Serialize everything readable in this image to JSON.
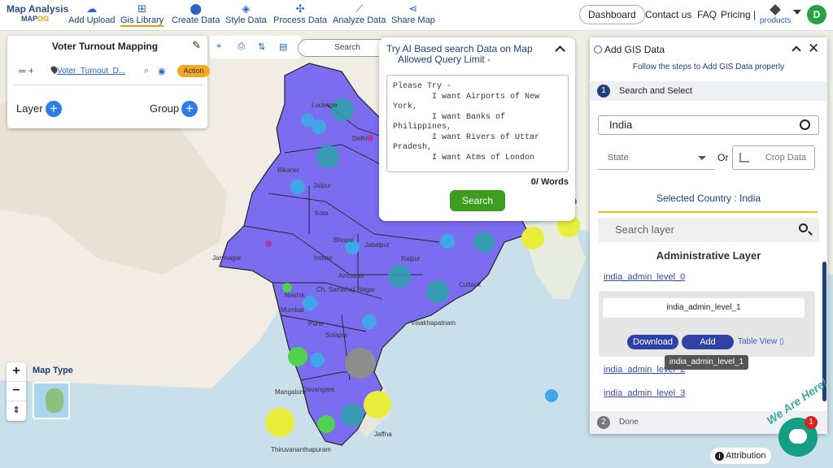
{
  "app": {
    "logo_line1": "Map Analysis",
    "logo_line2a": "MAP",
    "logo_line2b": "OG"
  },
  "nav": [
    {
      "label": "Add Upload",
      "icon": "cloud-upload-icon"
    },
    {
      "label": "Gis Library",
      "icon": "library-icon"
    },
    {
      "label": "Create Data",
      "icon": "pin-icon"
    },
    {
      "label": "Style Data",
      "icon": "paint-icon"
    },
    {
      "label": "Process Data",
      "icon": "process-icon"
    },
    {
      "label": "Analyze Data",
      "icon": "analyze-icon"
    },
    {
      "label": "Share Map",
      "icon": "share-icon"
    }
  ],
  "top_right": {
    "dashboard": "Dashboard",
    "contact": "Contact us",
    "faq": "FAQ",
    "pricing": "Pricing |",
    "products": "products",
    "avatar": "D"
  },
  "left_panel": {
    "title": "Voter Turnout Mapping",
    "layer_name": "Voter_Turnout_D...",
    "action": "Action",
    "layer_label": "Layer",
    "group_label": "Group"
  },
  "map_search": {
    "placeholder": "Search"
  },
  "ai_panel": {
    "title": "Try AI Based search Data on Map",
    "subtitle": "Allowed Query Limit -",
    "textarea": "Please Try -\n        I want Airports of New\nYork,\n        I want Banks of\nPhilippines,\n        I want Rivers of Uttar\nPradesh,\n        I want Atms of London",
    "words": "0/ Words",
    "search_button": "Search"
  },
  "gis_panel": {
    "title": "Add GIS Data",
    "subtitle": "Follow the steps to Add GIS Data properly",
    "step1_num": "1",
    "step1_label": "Search and Select",
    "country_value": "India",
    "state_placeholder": "State",
    "or": "Or",
    "crop": "Crop Data",
    "selected_country": "Selected Country : India",
    "search_layer_placeholder": "Search layer",
    "section_heading": "Administrative Layer",
    "links": [
      "india_admin_level_0",
      "india_admin_level_2",
      "india_admin_level_3"
    ],
    "card_title": "india_admin_level_1",
    "download": "Download",
    "add": "Add",
    "table_view": "Table View",
    "tooltip": "india_admin_level_1",
    "step2_num": "2",
    "step2_label": "Done"
  },
  "map_controls": {
    "zoom_in": "+",
    "zoom_out": "−",
    "map_type": "Map Type",
    "attribution": "Attribution",
    "we_are_here": "We Are Here!",
    "chat_badge": "1"
  },
  "map_labels": [
    "Lucknow",
    "Delhi",
    "Bikaner",
    "Jaipur",
    "Kota",
    "Bhopal",
    "Indore",
    "Jabalpur",
    "Raipur",
    "Nashik",
    "Ch. Sambhaji Nagar",
    "Amravati",
    "Cuttack",
    "Mumbai",
    "Pune",
    "Solapur",
    "Davangere",
    "Mangaluru",
    "Jaffna",
    "Thiruvananthapuram",
    "Jamnagar",
    "Visakhapatnam"
  ],
  "colors": {
    "primary": "#1e3f7a",
    "accent": "#2f41a3",
    "go": "#3c9d1f",
    "action": "#f6a821",
    "highlight": "#7b6cf0"
  }
}
